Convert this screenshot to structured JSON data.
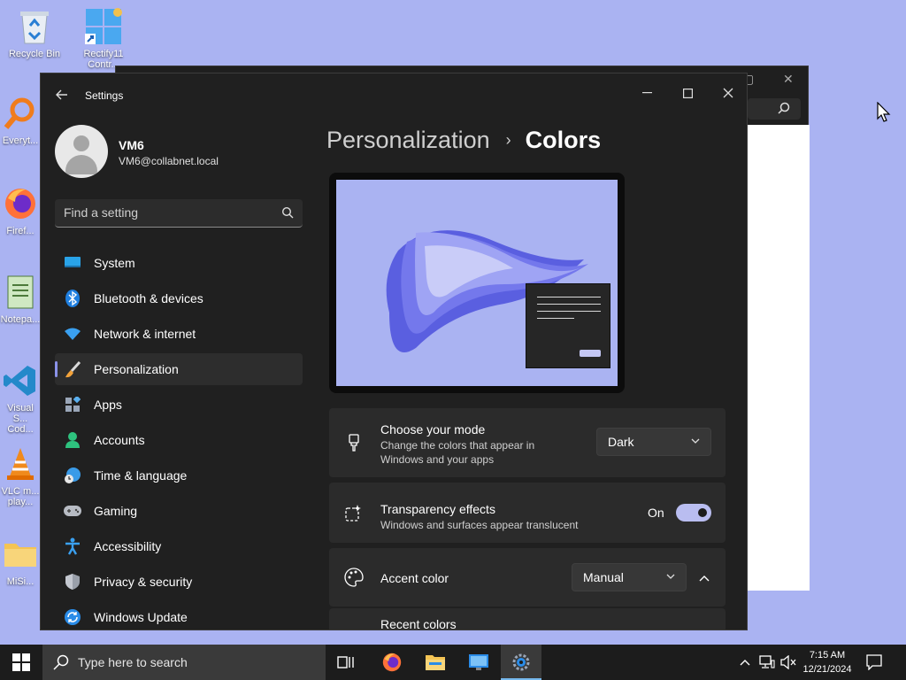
{
  "desktop": {
    "icons": [
      {
        "label": "Recycle Bin",
        "icon": "recycle-bin-icon"
      },
      {
        "label": "Rectify11 Contr...",
        "icon": "rectify11-icon"
      },
      {
        "label": "Everyt...",
        "icon": "everything-icon"
      },
      {
        "label": "Firef...",
        "icon": "firefox-icon"
      },
      {
        "label": "Notepa...",
        "icon": "notepad-icon"
      },
      {
        "label": "Visual S... Cod...",
        "icon": "vscode-icon"
      },
      {
        "label": "VLC m... play...",
        "icon": "vlc-icon"
      },
      {
        "label": "MiSi...",
        "icon": "folder-icon"
      }
    ]
  },
  "settings": {
    "app_title": "Settings",
    "user": {
      "name": "VM6",
      "email": "VM6@collabnet.local"
    },
    "search_placeholder": "Find a setting",
    "nav": [
      {
        "label": "System",
        "icon": "monitor-icon",
        "active": false
      },
      {
        "label": "Bluetooth & devices",
        "icon": "bluetooth-icon",
        "active": false
      },
      {
        "label": "Network & internet",
        "icon": "wifi-icon",
        "active": false
      },
      {
        "label": "Personalization",
        "icon": "paintbrush-icon",
        "active": true
      },
      {
        "label": "Apps",
        "icon": "apps-icon",
        "active": false
      },
      {
        "label": "Accounts",
        "icon": "person-icon",
        "active": false
      },
      {
        "label": "Time & language",
        "icon": "globe-clock-icon",
        "active": false
      },
      {
        "label": "Gaming",
        "icon": "gamepad-icon",
        "active": false
      },
      {
        "label": "Accessibility",
        "icon": "accessibility-icon",
        "active": false
      },
      {
        "label": "Privacy & security",
        "icon": "shield-icon",
        "active": false
      },
      {
        "label": "Windows Update",
        "icon": "update-icon",
        "active": false
      }
    ],
    "breadcrumb": {
      "parent": "Personalization",
      "separator": "›",
      "current": "Colors"
    },
    "mode": {
      "title": "Choose your mode",
      "subtitle_line1": "Change the colors that appear in",
      "subtitle_line2": "Windows and your apps",
      "value": "Dark"
    },
    "transparency": {
      "title": "Transparency effects",
      "subtitle": "Windows and surfaces appear translucent",
      "state_label": "On",
      "on": true
    },
    "accent": {
      "title": "Accent color",
      "value": "Manual"
    },
    "recent_colors_label": "Recent colors"
  },
  "taskbar": {
    "search_placeholder": "Type here to search",
    "apps": [
      "task-view-icon",
      "firefox-icon",
      "file-explorer-icon",
      "remote-desktop-icon",
      "settings-gear-icon"
    ],
    "time": "7:15 AM",
    "date": "12/21/2024"
  },
  "colors": {
    "desktop_bg": "#aab3f2",
    "accent": "#8a92e8",
    "window_bg": "#202020",
    "card_bg": "#2b2b2b",
    "taskbar_bg": "#1c1c1c"
  }
}
